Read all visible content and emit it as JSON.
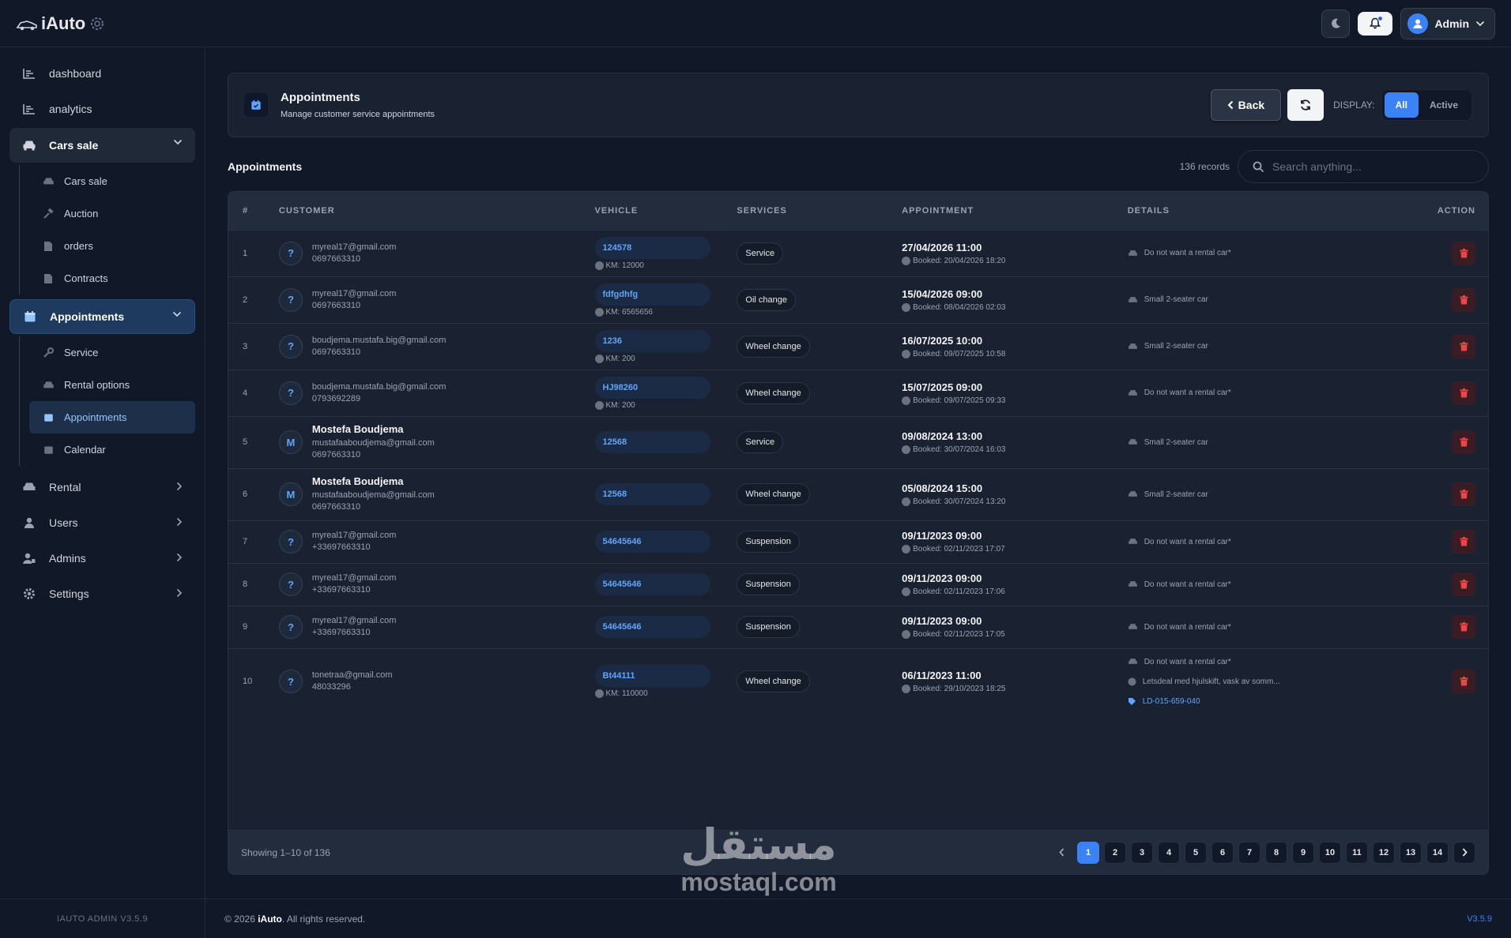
{
  "app": {
    "logo_text": "iAuto"
  },
  "topbar": {
    "user_name": "Admin"
  },
  "sidebar": {
    "items": [
      {
        "label": "dashboard"
      },
      {
        "label": "analytics"
      },
      {
        "label": "Cars sale"
      },
      {
        "label": "Appointments"
      },
      {
        "label": "Rental"
      },
      {
        "label": "Users"
      },
      {
        "label": "Admins"
      },
      {
        "label": "Settings"
      }
    ],
    "cars_sub": [
      {
        "label": "Cars sale"
      },
      {
        "label": "Auction"
      },
      {
        "label": "orders"
      },
      {
        "label": "Contracts"
      }
    ],
    "appt_sub": [
      {
        "label": "Service"
      },
      {
        "label": "Rental options"
      },
      {
        "label": "Appointments"
      },
      {
        "label": "Calendar"
      }
    ],
    "version": "IAUTO ADMIN V3.5.9"
  },
  "header": {
    "title": "Appointments",
    "subtitle": "Manage customer service appointments",
    "back_label": "Back",
    "display_label": "DISPLAY:",
    "toggle_all": "All",
    "toggle_active": "Active"
  },
  "section": {
    "title": "Appointments",
    "records": "136 records",
    "search_placeholder": "Search anything..."
  },
  "table": {
    "columns": [
      "#",
      "CUSTOMER",
      "VEHICLE",
      "SERVICES",
      "APPOINTMENT",
      "DETAILS",
      "ACTION"
    ],
    "rows": [
      {
        "num": "1",
        "avatar": "?",
        "name": "",
        "email": "myreal17@gmail.com",
        "phone": "0697663310",
        "vehicle": "124578",
        "km": "KM: 12000",
        "service": "Service",
        "date": "27/04/2026 11:00",
        "booked": "Booked: 20/04/2026 18:20",
        "details": [
          "Do not want a rental car*"
        ]
      },
      {
        "num": "2",
        "avatar": "?",
        "name": "",
        "email": "myreal17@gmail.com",
        "phone": "0697663310",
        "vehicle": "fdfgdhfg",
        "km": "KM: 6565656",
        "service": "Oil change",
        "date": "15/04/2026 09:00",
        "booked": "Booked: 08/04/2026 02:03",
        "details": [
          "Small 2-seater car"
        ]
      },
      {
        "num": "3",
        "avatar": "?",
        "name": "",
        "email": "boudjema.mustafa.big@gmail.com",
        "phone": "0697663310",
        "vehicle": "1236",
        "km": "KM: 200",
        "service": "Wheel change",
        "date": "16/07/2025 10:00",
        "booked": "Booked: 09/07/2025 10:58",
        "details": [
          "Small 2-seater car"
        ]
      },
      {
        "num": "4",
        "avatar": "?",
        "name": "",
        "email": "boudjema.mustafa.big@gmail.com",
        "phone": "0793692289",
        "vehicle": "HJ98260",
        "km": "KM: 200",
        "service": "Wheel change",
        "date": "15/07/2025 09:00",
        "booked": "Booked: 09/07/2025 09:33",
        "details": [
          "Do not want a rental car*"
        ]
      },
      {
        "num": "5",
        "avatar": "M",
        "name": "Mostefa Boudjema",
        "email": "mustafaaboudjema@gmail.com",
        "phone": "0697663310",
        "vehicle": "12568",
        "km": "",
        "service": "Service",
        "date": "09/08/2024 13:00",
        "booked": "Booked: 30/07/2024 16:03",
        "details": [
          "Small 2-seater car"
        ]
      },
      {
        "num": "6",
        "avatar": "M",
        "name": "Mostefa Boudjema",
        "email": "mustafaaboudjema@gmail.com",
        "phone": "0697663310",
        "vehicle": "12568",
        "km": "",
        "service": "Wheel change",
        "date": "05/08/2024 15:00",
        "booked": "Booked: 30/07/2024 13:20",
        "details": [
          "Small 2-seater car"
        ]
      },
      {
        "num": "7",
        "avatar": "?",
        "name": "",
        "email": "myreal17@gmail.com",
        "phone": "+33697663310",
        "vehicle": "54645646",
        "km": "",
        "service": "Suspension",
        "date": "09/11/2023 09:00",
        "booked": "Booked: 02/11/2023 17:07",
        "details": [
          "Do not want a rental car*"
        ]
      },
      {
        "num": "8",
        "avatar": "?",
        "name": "",
        "email": "myreal17@gmail.com",
        "phone": "+33697663310",
        "vehicle": "54645646",
        "km": "",
        "service": "Suspension",
        "date": "09/11/2023 09:00",
        "booked": "Booked: 02/11/2023 17:06",
        "details": [
          "Do not want a rental car*"
        ]
      },
      {
        "num": "9",
        "avatar": "?",
        "name": "",
        "email": "myreal17@gmail.com",
        "phone": "+33697663310",
        "vehicle": "54645646",
        "km": "",
        "service": "Suspension",
        "date": "09/11/2023 09:00",
        "booked": "Booked: 02/11/2023 17:05",
        "details": [
          "Do not want a rental car*"
        ]
      },
      {
        "num": "10",
        "avatar": "?",
        "name": "",
        "email": "tonetraa@gmail.com",
        "phone": "48033296",
        "vehicle": "Bt44111",
        "km": "KM: 110000",
        "service": "Wheel change",
        "date": "06/11/2023 11:00",
        "booked": "Booked: 29/10/2023 18:25",
        "details": [
          "Do not want a rental car*",
          "Letsdeal med hjulskift, vask av somm...",
          "LD-015-659-040"
        ]
      }
    ]
  },
  "pagination": {
    "showing": "Showing 1–10 of 136",
    "pages": [
      "1",
      "2",
      "3",
      "4",
      "5",
      "6",
      "7",
      "8",
      "9",
      "10",
      "11",
      "12",
      "13",
      "14"
    ],
    "current": "1"
  },
  "footer": {
    "copyright_prefix": "© 2026",
    "brand": "iAuto",
    "copyright_suffix": ". All rights reserved.",
    "version": "V3.5.9"
  },
  "watermark": {
    "arabic": "مستقل",
    "latin": "mostaql.com"
  },
  "colors": {
    "accent": "#3b82f6",
    "danger": "#ef4444",
    "background": "#111827",
    "card": "#1a2232"
  }
}
